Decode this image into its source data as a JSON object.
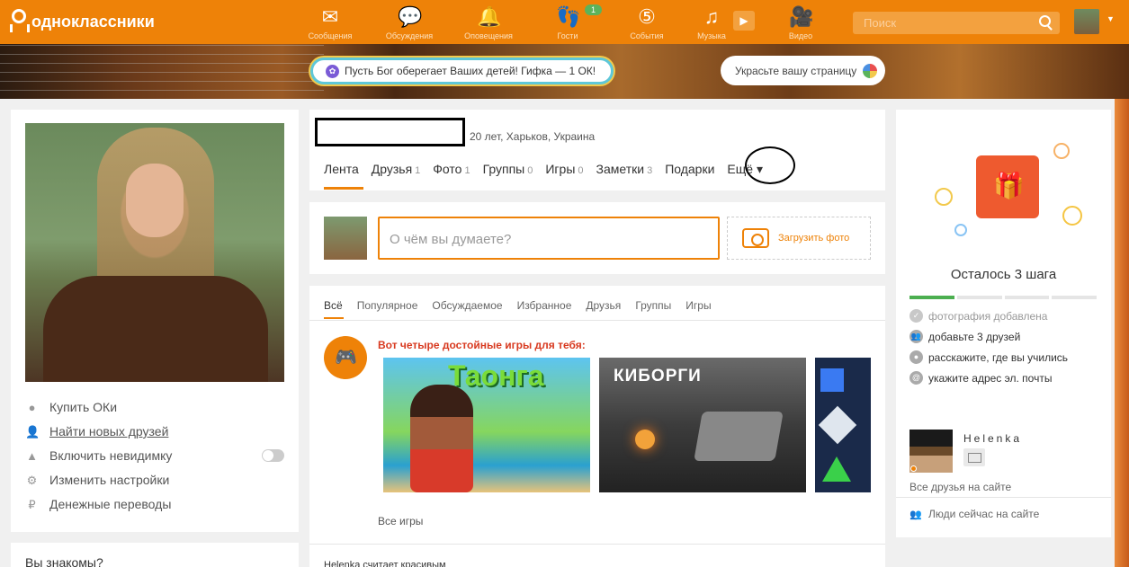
{
  "topbar": {
    "brand": "одноклассники",
    "nav": [
      {
        "label": "Сообщения",
        "icon": "envelope-icon"
      },
      {
        "label": "Обсуждения",
        "icon": "chat-bubbles-icon"
      },
      {
        "label": "Оповещения",
        "icon": "bell-icon"
      },
      {
        "label": "Гости",
        "icon": "footprints-icon",
        "badge": "1"
      },
      {
        "label": "События",
        "icon": "events-icon"
      },
      {
        "label": "Музыка",
        "icon": "music-note-icon"
      },
      {
        "label": "Видео",
        "icon": "video-camera-icon"
      }
    ],
    "search_placeholder": "Поиск"
  },
  "cover": {
    "gif_banner": "Пусть Бог оберегает Ваших детей! Гифка — 1 ОК!",
    "decorate_button": "Украсьте вашу страницу"
  },
  "left": {
    "menu": [
      {
        "label": "Купить ОКи",
        "icon": "ok-coin-icon"
      },
      {
        "label": "Найти новых друзей",
        "icon": "user-icon"
      },
      {
        "label": "Включить невидимку",
        "icon": "invisible-hat-icon"
      },
      {
        "label": "Изменить настройки",
        "icon": "gear-icon"
      },
      {
        "label": "Денежные переводы",
        "icon": "money-transfer-icon"
      }
    ],
    "second_card_title": "Вы знакомы?"
  },
  "profile": {
    "info": "20 лет, Харьков, Украина",
    "tabs": [
      {
        "label": "Лента",
        "count": ""
      },
      {
        "label": "Друзья",
        "count": "1"
      },
      {
        "label": "Фото",
        "count": "1"
      },
      {
        "label": "Группы",
        "count": "0"
      },
      {
        "label": "Игры",
        "count": "0"
      },
      {
        "label": "Заметки",
        "count": "3"
      },
      {
        "label": "Подарки",
        "count": ""
      },
      {
        "label": "Ещё ▾",
        "count": ""
      }
    ]
  },
  "post": {
    "placeholder": "О чём вы думаете?",
    "upload_label": "Загрузить фото"
  },
  "feed": {
    "tabs": [
      "Всё",
      "Популярное",
      "Обсуждаемое",
      "Избранное",
      "Друзья",
      "Группы",
      "Игры"
    ],
    "promo_title": "Вот четыре достойные игры для тебя:",
    "games": [
      "Таонга",
      "КИБОРГИ"
    ],
    "all_games": "Все игры",
    "next_item": "Helenka считает красивым"
  },
  "right": {
    "steps_title": "Осталось 3 шага",
    "progress_done": 1,
    "progress_total": 4,
    "steps": [
      {
        "label": "фотография добавлена",
        "done": true
      },
      {
        "label": "добавьте 3 друзей",
        "done": false
      },
      {
        "label": "расскажите, где вы учились",
        "done": false
      },
      {
        "label": "укажите адрес эл. почты",
        "done": false
      }
    ],
    "friend_name": "Helenka",
    "all_friends": "Все друзья на сайте",
    "people_now": "Люди сейчас на сайте"
  },
  "colors": {
    "brand": "#ee8208",
    "promo_red": "#d83a20",
    "progress_green": "#4caf50"
  }
}
